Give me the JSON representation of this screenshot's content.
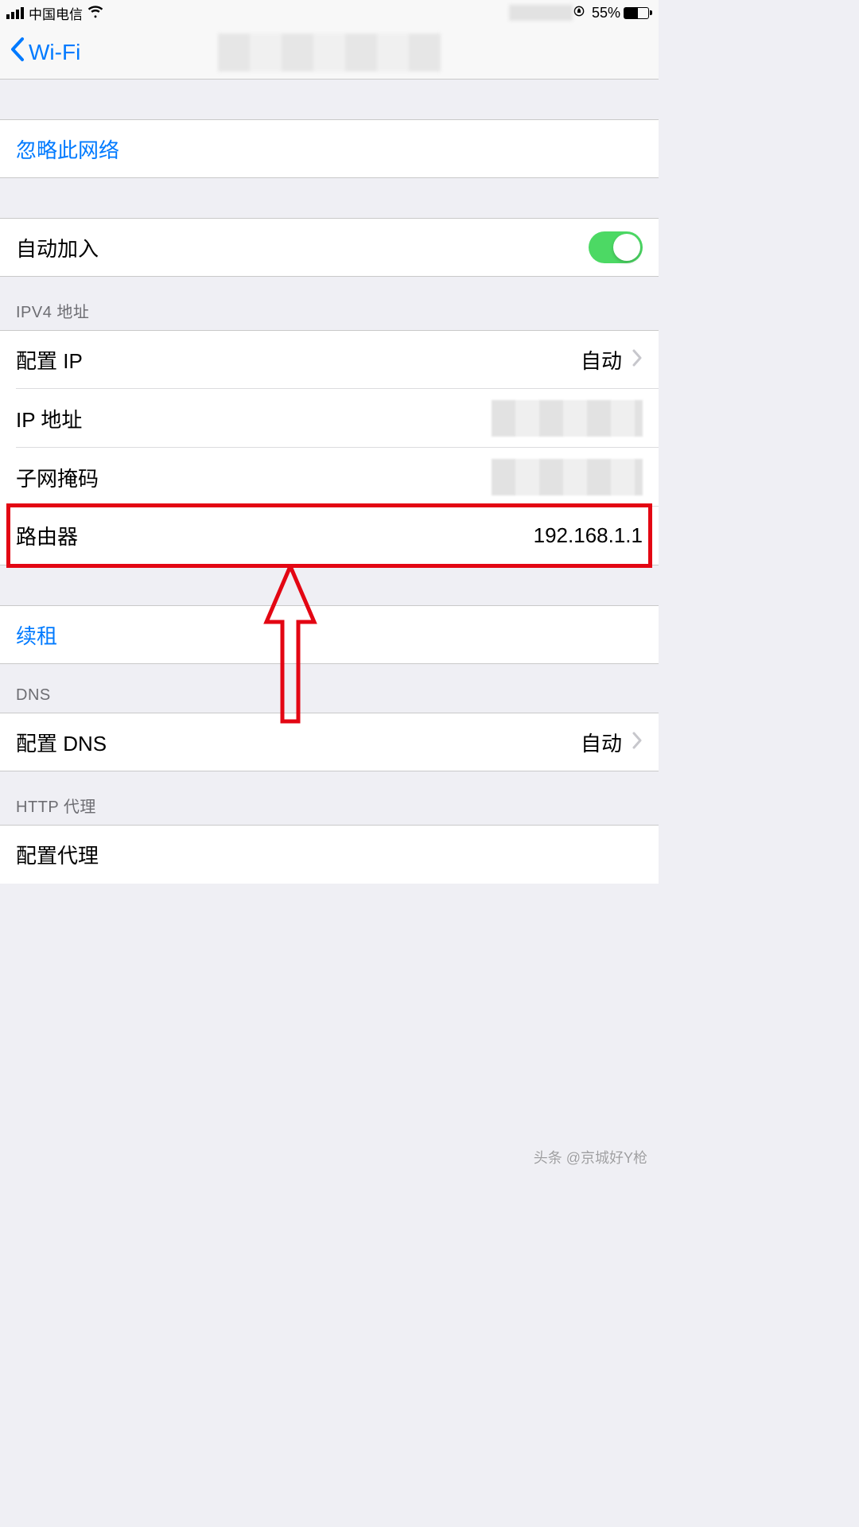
{
  "statusbar": {
    "carrier": "中国电信",
    "battery": "55%"
  },
  "navbar": {
    "back_label": "Wi-Fi"
  },
  "forget": {
    "label": "忽略此网络"
  },
  "auto_join": {
    "label": "自动加入"
  },
  "ipv4": {
    "header": "IPV4 地址",
    "configure_ip_label": "配置 IP",
    "configure_ip_value": "自动",
    "ip_address_label": "IP 地址",
    "subnet_label": "子网掩码",
    "router_label": "路由器",
    "router_value": "192.168.1.1"
  },
  "renew": {
    "label": "续租"
  },
  "dns": {
    "header": "DNS",
    "configure_dns_label": "配置 DNS",
    "configure_dns_value": "自动"
  },
  "http_proxy": {
    "header": "HTTP 代理",
    "configure_proxy_label": "配置代理"
  },
  "watermark": "头条 @京城好Y枪"
}
